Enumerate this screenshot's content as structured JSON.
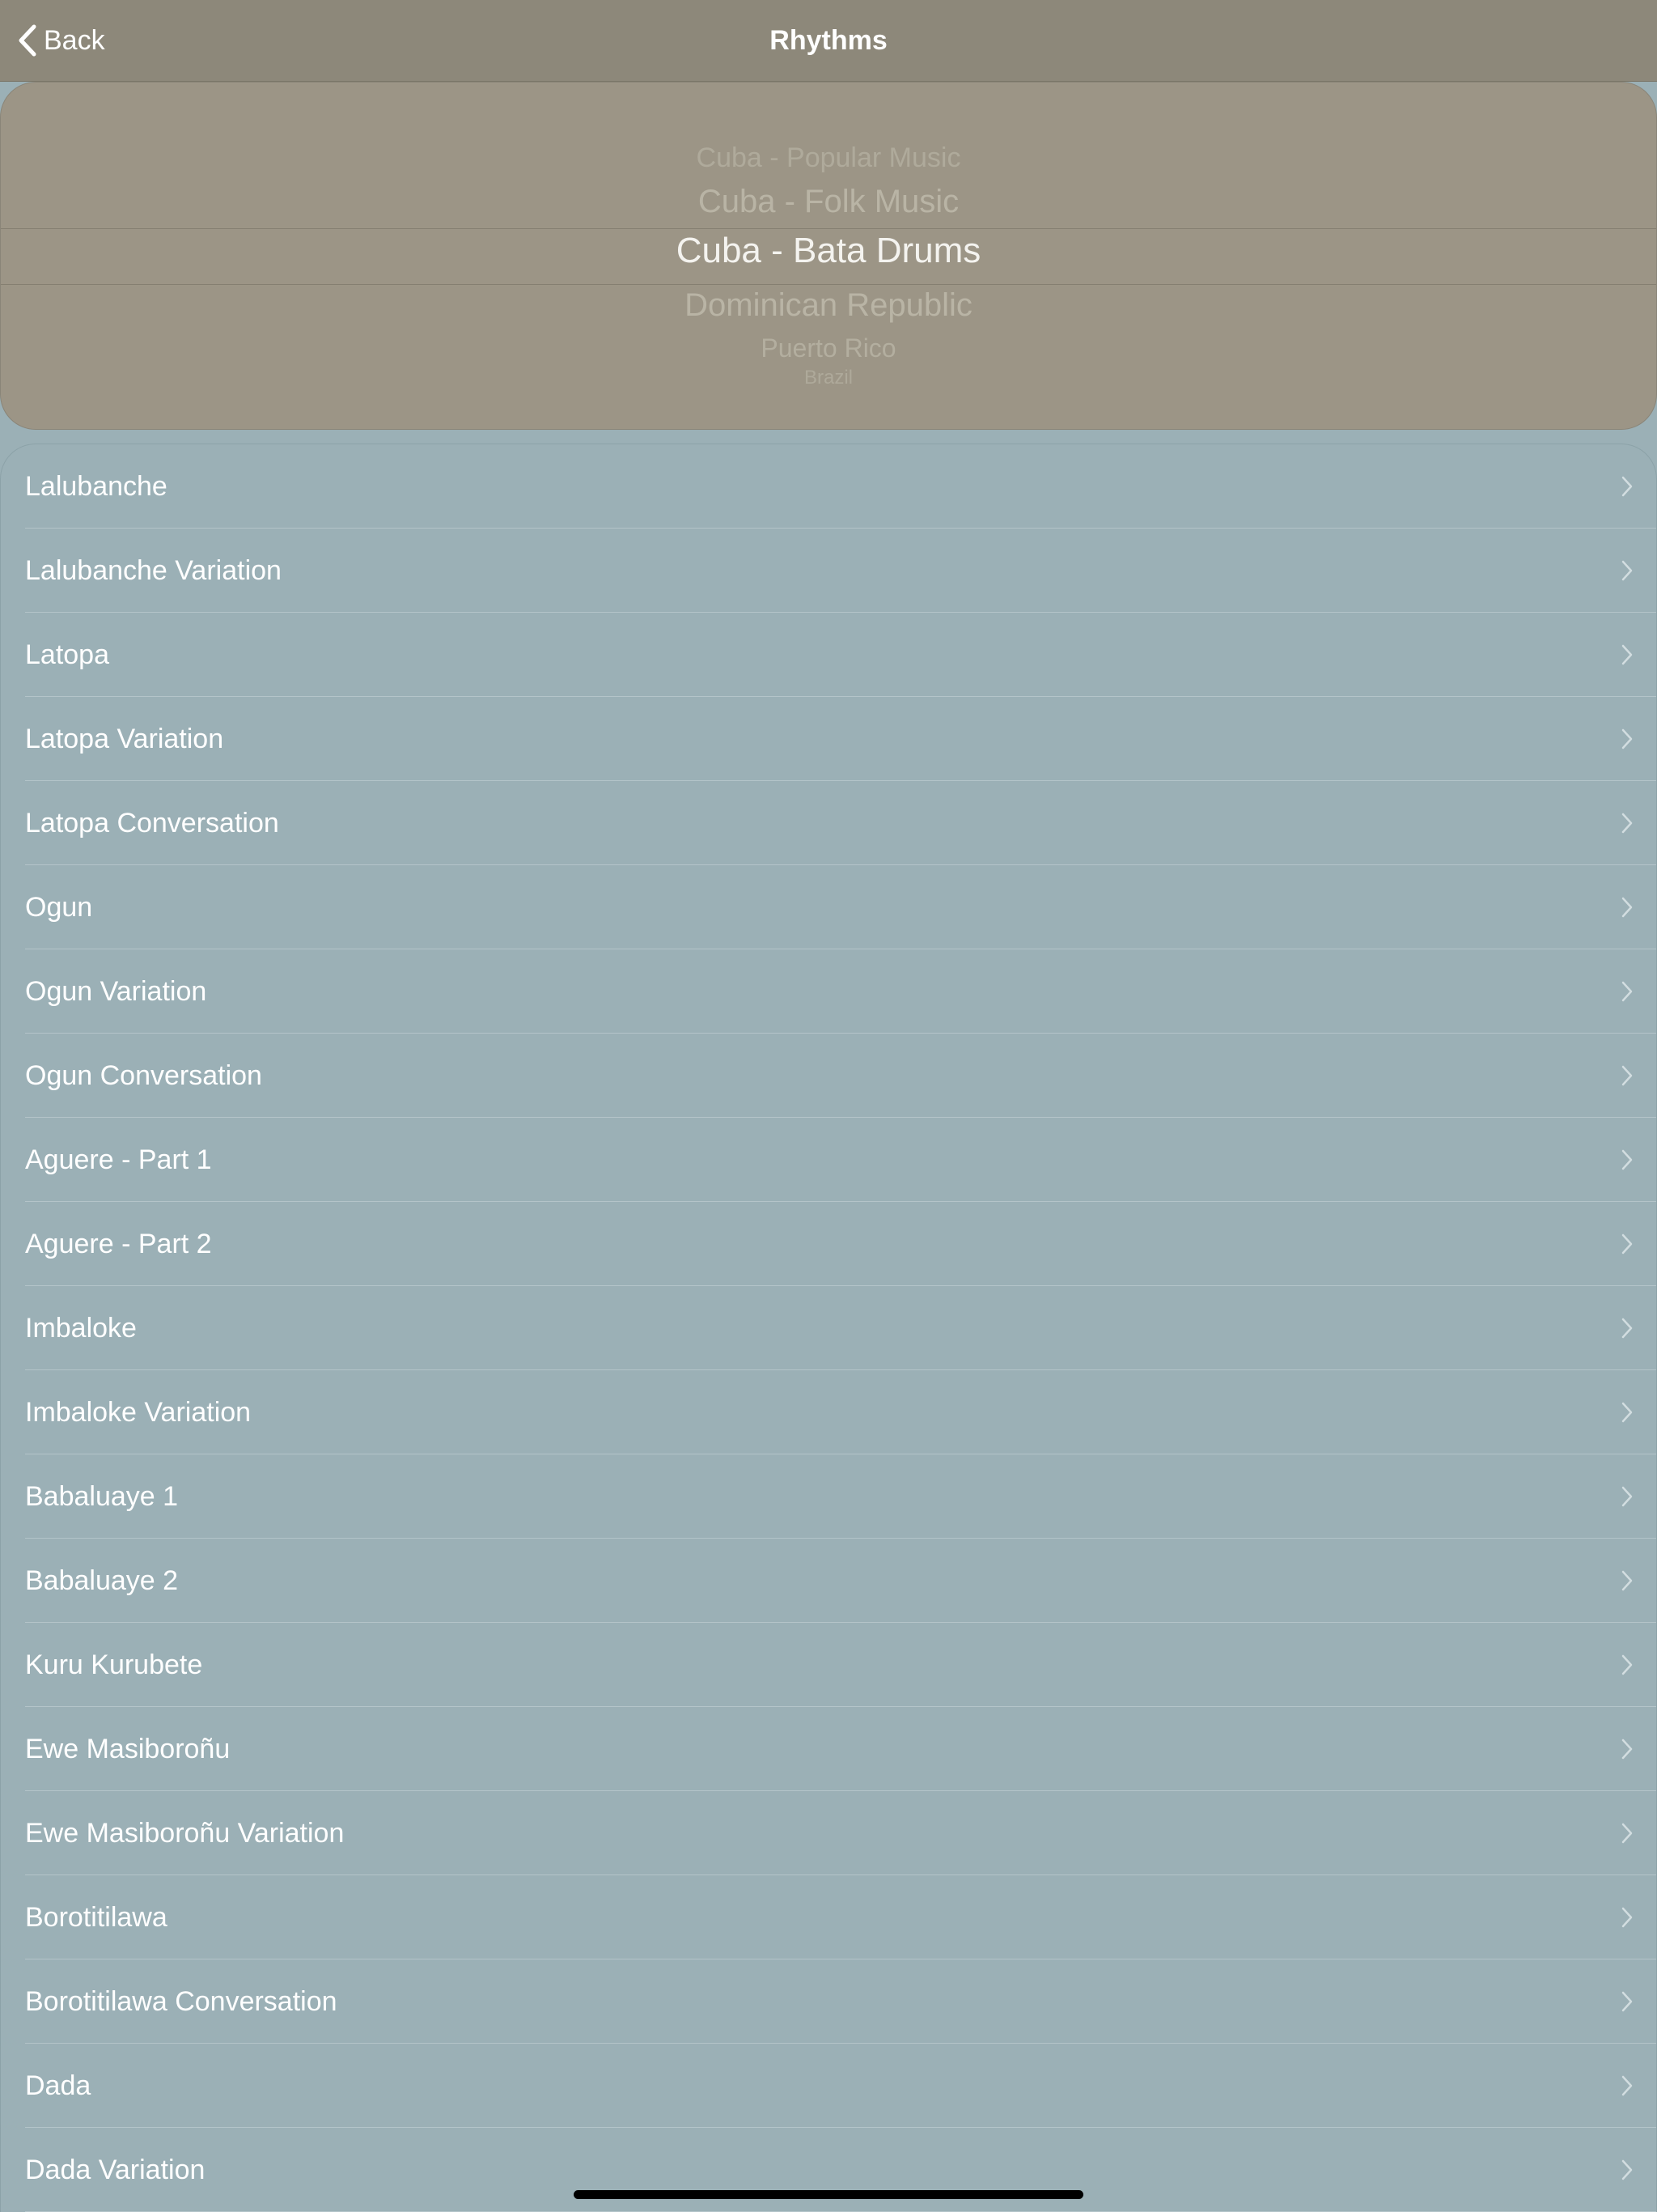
{
  "navbar": {
    "back_label": "Back",
    "title": "Rhythms"
  },
  "picker": {
    "items": [
      "Cuba - Popular Music",
      "Cuba - Folk Music",
      "Cuba - Bata Drums",
      "Dominican Republic",
      "Puerto Rico",
      "Brazil"
    ],
    "selected": "Cuba - Bata Drums"
  },
  "rhythms": [
    "Lalubanche",
    "Lalubanche Variation",
    "Latopa",
    "Latopa Variation",
    "Latopa Conversation",
    "Ogun",
    "Ogun Variation",
    "Ogun Conversation",
    "Aguere - Part 1",
    "Aguere - Part 2",
    "Imbaloke",
    "Imbaloke Variation",
    "Babaluaye 1",
    "Babaluaye 2",
    "Kuru Kurubete",
    "Ewe Masiboroñu",
    "Ewe Masiboroñu Variation",
    "Borotitilawa",
    "Borotitilawa Conversation",
    "Dada",
    "Dada Variation"
  ],
  "colors": {
    "navbar": "#8d887a",
    "picker_background": "#9c9586",
    "list_background": "#9bb0b6",
    "text": "#ffffff"
  },
  "icons": {
    "back": "chevron-left-icon",
    "row_disclosure": "chevron-right-icon"
  }
}
